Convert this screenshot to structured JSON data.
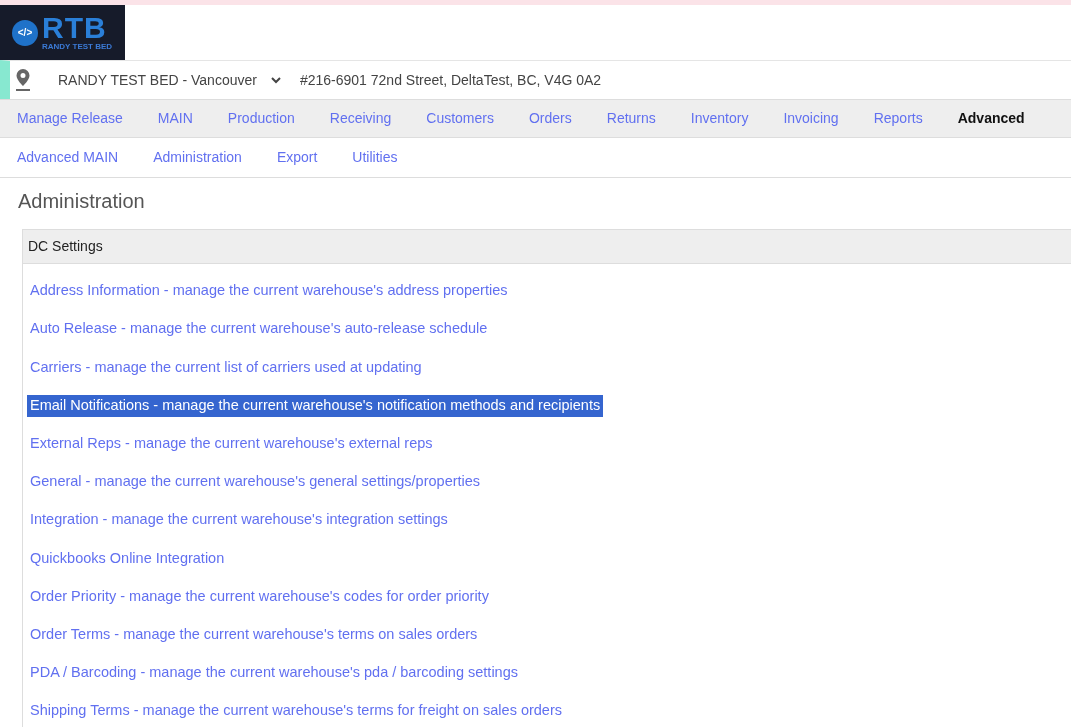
{
  "logo": {
    "letters": "RTB",
    "tagline": "RANDY TEST BED",
    "symbol": "</>"
  },
  "location": {
    "warehouse": "RANDY TEST BED - Vancouver",
    "address": "#216-6901 72nd Street, DeltaTest, BC, V4G 0A2"
  },
  "main_nav": [
    {
      "label": "Manage Release",
      "selected": false
    },
    {
      "label": "MAIN",
      "selected": false
    },
    {
      "label": "Production",
      "selected": false
    },
    {
      "label": "Receiving",
      "selected": false
    },
    {
      "label": "Customers",
      "selected": false
    },
    {
      "label": "Orders",
      "selected": false
    },
    {
      "label": "Returns",
      "selected": false
    },
    {
      "label": "Inventory",
      "selected": false
    },
    {
      "label": "Invoicing",
      "selected": false
    },
    {
      "label": "Reports",
      "selected": false
    },
    {
      "label": "Advanced",
      "selected": true
    }
  ],
  "sub_nav": [
    {
      "label": "Advanced MAIN",
      "selected": false
    },
    {
      "label": "Administration",
      "selected": false
    },
    {
      "label": "Export",
      "selected": false
    },
    {
      "label": "Utilities",
      "selected": false
    }
  ],
  "page_title": "Administration",
  "panel": {
    "title": "DC Settings",
    "links": [
      {
        "label": "Address Information - manage the current warehouse's address properties",
        "selected": false
      },
      {
        "label": "Auto Release - manage the current warehouse's auto-release schedule",
        "selected": false
      },
      {
        "label": "Carriers - manage the current list of carriers used at updating",
        "selected": false
      },
      {
        "label": "Email Notifications - manage the current warehouse's notification methods and recipients",
        "selected": true
      },
      {
        "label": "External Reps - manage the current warehouse's external reps",
        "selected": false
      },
      {
        "label": "General - manage the current warehouse's general settings/properties",
        "selected": false
      },
      {
        "label": "Integration - manage the current warehouse's integration settings",
        "selected": false
      },
      {
        "label": "Quickbooks Online Integration",
        "selected": false
      },
      {
        "label": "Order Priority - manage the current warehouse's codes for order priority",
        "selected": false
      },
      {
        "label": "Order Terms - manage the current warehouse's terms on sales orders",
        "selected": false
      },
      {
        "label": "PDA / Barcoding - manage the current warehouse's pda / barcoding settings",
        "selected": false
      },
      {
        "label": "Shipping Terms - manage the current warehouse's terms for freight on sales orders",
        "selected": false
      }
    ]
  }
}
